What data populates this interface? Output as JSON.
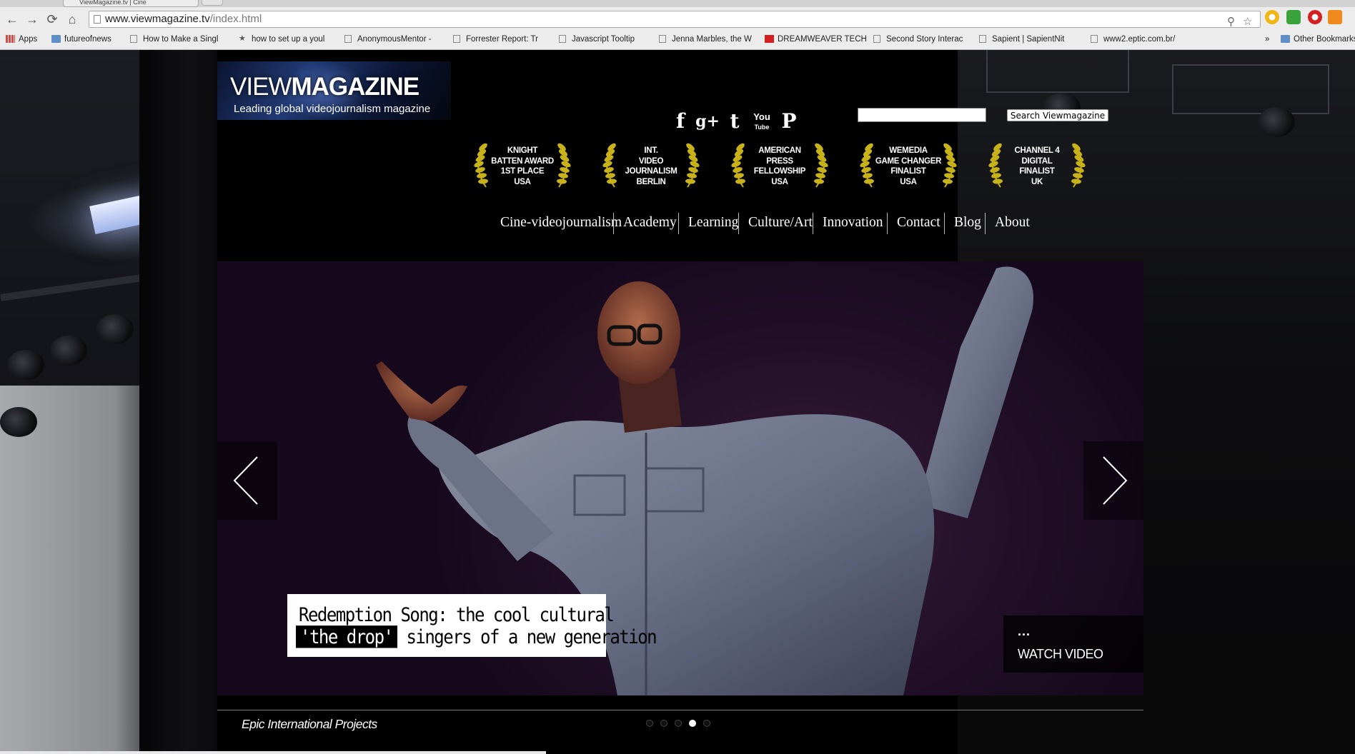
{
  "browser": {
    "tab_title": "ViewMagazine.tv | Cine",
    "url_host": "www.viewmagazine.tv",
    "url_path": "/index.html",
    "bookmarks": [
      {
        "label": "Apps",
        "icon": "apps-grid-icon"
      },
      {
        "label": "futureofnews",
        "icon": "folder-icon"
      },
      {
        "label": "How to Make a Singl",
        "icon": "page-icon"
      },
      {
        "label": "how to set up a youl",
        "icon": "star-icon"
      },
      {
        "label": "AnonymousMentor -",
        "icon": "page-icon"
      },
      {
        "label": "Forrester Report: Tr",
        "icon": "page-icon"
      },
      {
        "label": "Javascript Tooltip",
        "icon": "page-icon"
      },
      {
        "label": "Jenna Marbles, the W",
        "icon": "page-icon"
      },
      {
        "label": "DREAMWEAVER TECH",
        "icon": "youtube-icon"
      },
      {
        "label": "Second Story Interac",
        "icon": "page-icon"
      },
      {
        "label": "Sapient | SapientNit",
        "icon": "page-icon"
      },
      {
        "label": "www2.eptic.com.br/",
        "icon": "page-icon"
      }
    ],
    "overflow_label": "»",
    "other_bookmarks": "Other Bookmarks"
  },
  "site": {
    "logo": {
      "title_light": "VIEW",
      "title_bold": "MAGAZINE",
      "tagline": "Leading global videojournalism  magazine"
    },
    "social_icons": [
      "facebook-icon",
      "google-plus-icon",
      "twitter-icon",
      "youtube-icon",
      "pinterest-icon"
    ],
    "social_glyphs": {
      "facebook": "f",
      "google_plus": "g+",
      "twitter": "t",
      "youtube_top": "You",
      "youtube_bottom": "Tube",
      "pinterest": "P"
    },
    "search": {
      "value": "",
      "button_label": "Search Viewmagazine"
    },
    "awards": [
      [
        "KNIGHT",
        "BATTEN AWARD",
        "1st PLACE",
        "USA"
      ],
      [
        "INT.",
        "VIDEO",
        "JOURNALISM",
        "BERLIN"
      ],
      [
        "AMERICAN",
        "PRESS",
        "FELLOWSHIP",
        "USA"
      ],
      [
        "WEMEDIA",
        "GAME CHANGER",
        "FINALIST",
        "USA"
      ],
      [
        "CHANNEL 4",
        "DIGITAL",
        "FINALIST",
        "UK"
      ]
    ],
    "nav": [
      "Cine-videojournalism",
      "Academy",
      "Learning",
      "Culture/Art",
      "Innovation",
      "Contact",
      "Blog",
      "About"
    ],
    "slide": {
      "caption_line1": "Redemption Song: the cool cultural",
      "caption_highlight": "'the drop'",
      "caption_rest": " singers of a new generation",
      "watch_dots": "...",
      "watch_label": "WATCH VIDEO"
    },
    "footer_text": "Epic International Projects",
    "pager": {
      "count": 5,
      "active": 4
    }
  },
  "colors": {
    "accent_gold": "#c8b21a",
    "page_black": "#000000",
    "slide_purple": "#24112a"
  }
}
